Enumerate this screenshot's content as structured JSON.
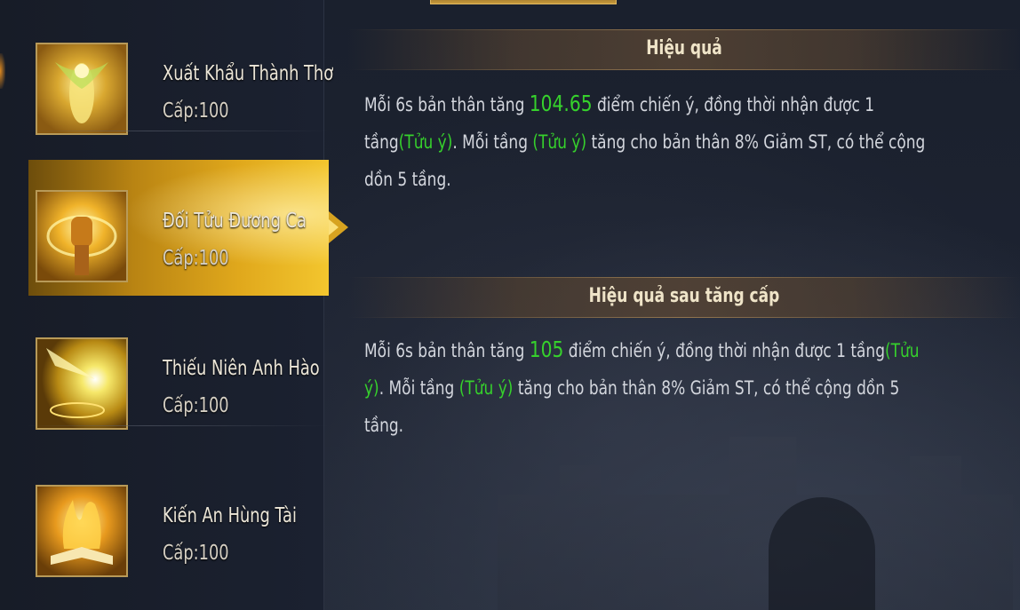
{
  "skills": [
    {
      "name": "Xuất Khẩu Thành Thơ",
      "level": "Cấp:100",
      "icon": "golden-figure-icon",
      "selected": false
    },
    {
      "name": "Đối Tửu Đương Ca",
      "level": "Cấp:100",
      "icon": "golden-fist-icon",
      "selected": true
    },
    {
      "name": "Thiếu Niên Anh Hào",
      "level": "Cấp:100",
      "icon": "light-burst-icon",
      "selected": false
    },
    {
      "name": "Kiến An Hùng Tài",
      "level": "Cấp:100",
      "icon": "flaming-book-icon",
      "selected": false
    }
  ],
  "effect": {
    "title": "Hiệu quả",
    "p1": "Mỗi 6s bản thân tăng ",
    "value": "104.65",
    "p2": " điểm chiến ý, đồng thời nhận được 1 tầng",
    "tag1": "(Tửu ý)",
    "p3": ". Mỗi tầng ",
    "tag2": "(Tửu ý)",
    "p4": " tăng cho bản thân 8% Giảm ST, có thể cộng dồn 5 tầng."
  },
  "upgrade": {
    "title": "Hiệu quả sau tăng cấp",
    "p1": "Mỗi 6s bản thân tăng ",
    "value": "105",
    "p2": " điểm chiến ý, đồng thời nhận được 1 tầng",
    "tag1": "(Tửu ý)",
    "p3": ". Mỗi tầng ",
    "tag2": "(Tửu ý)",
    "p4": " tăng cho bản thân 8% Giảm ST, có thể cộng dồn 5 tầng."
  },
  "colors": {
    "highlight": "#36d12c",
    "selected": "#e0a81c"
  }
}
